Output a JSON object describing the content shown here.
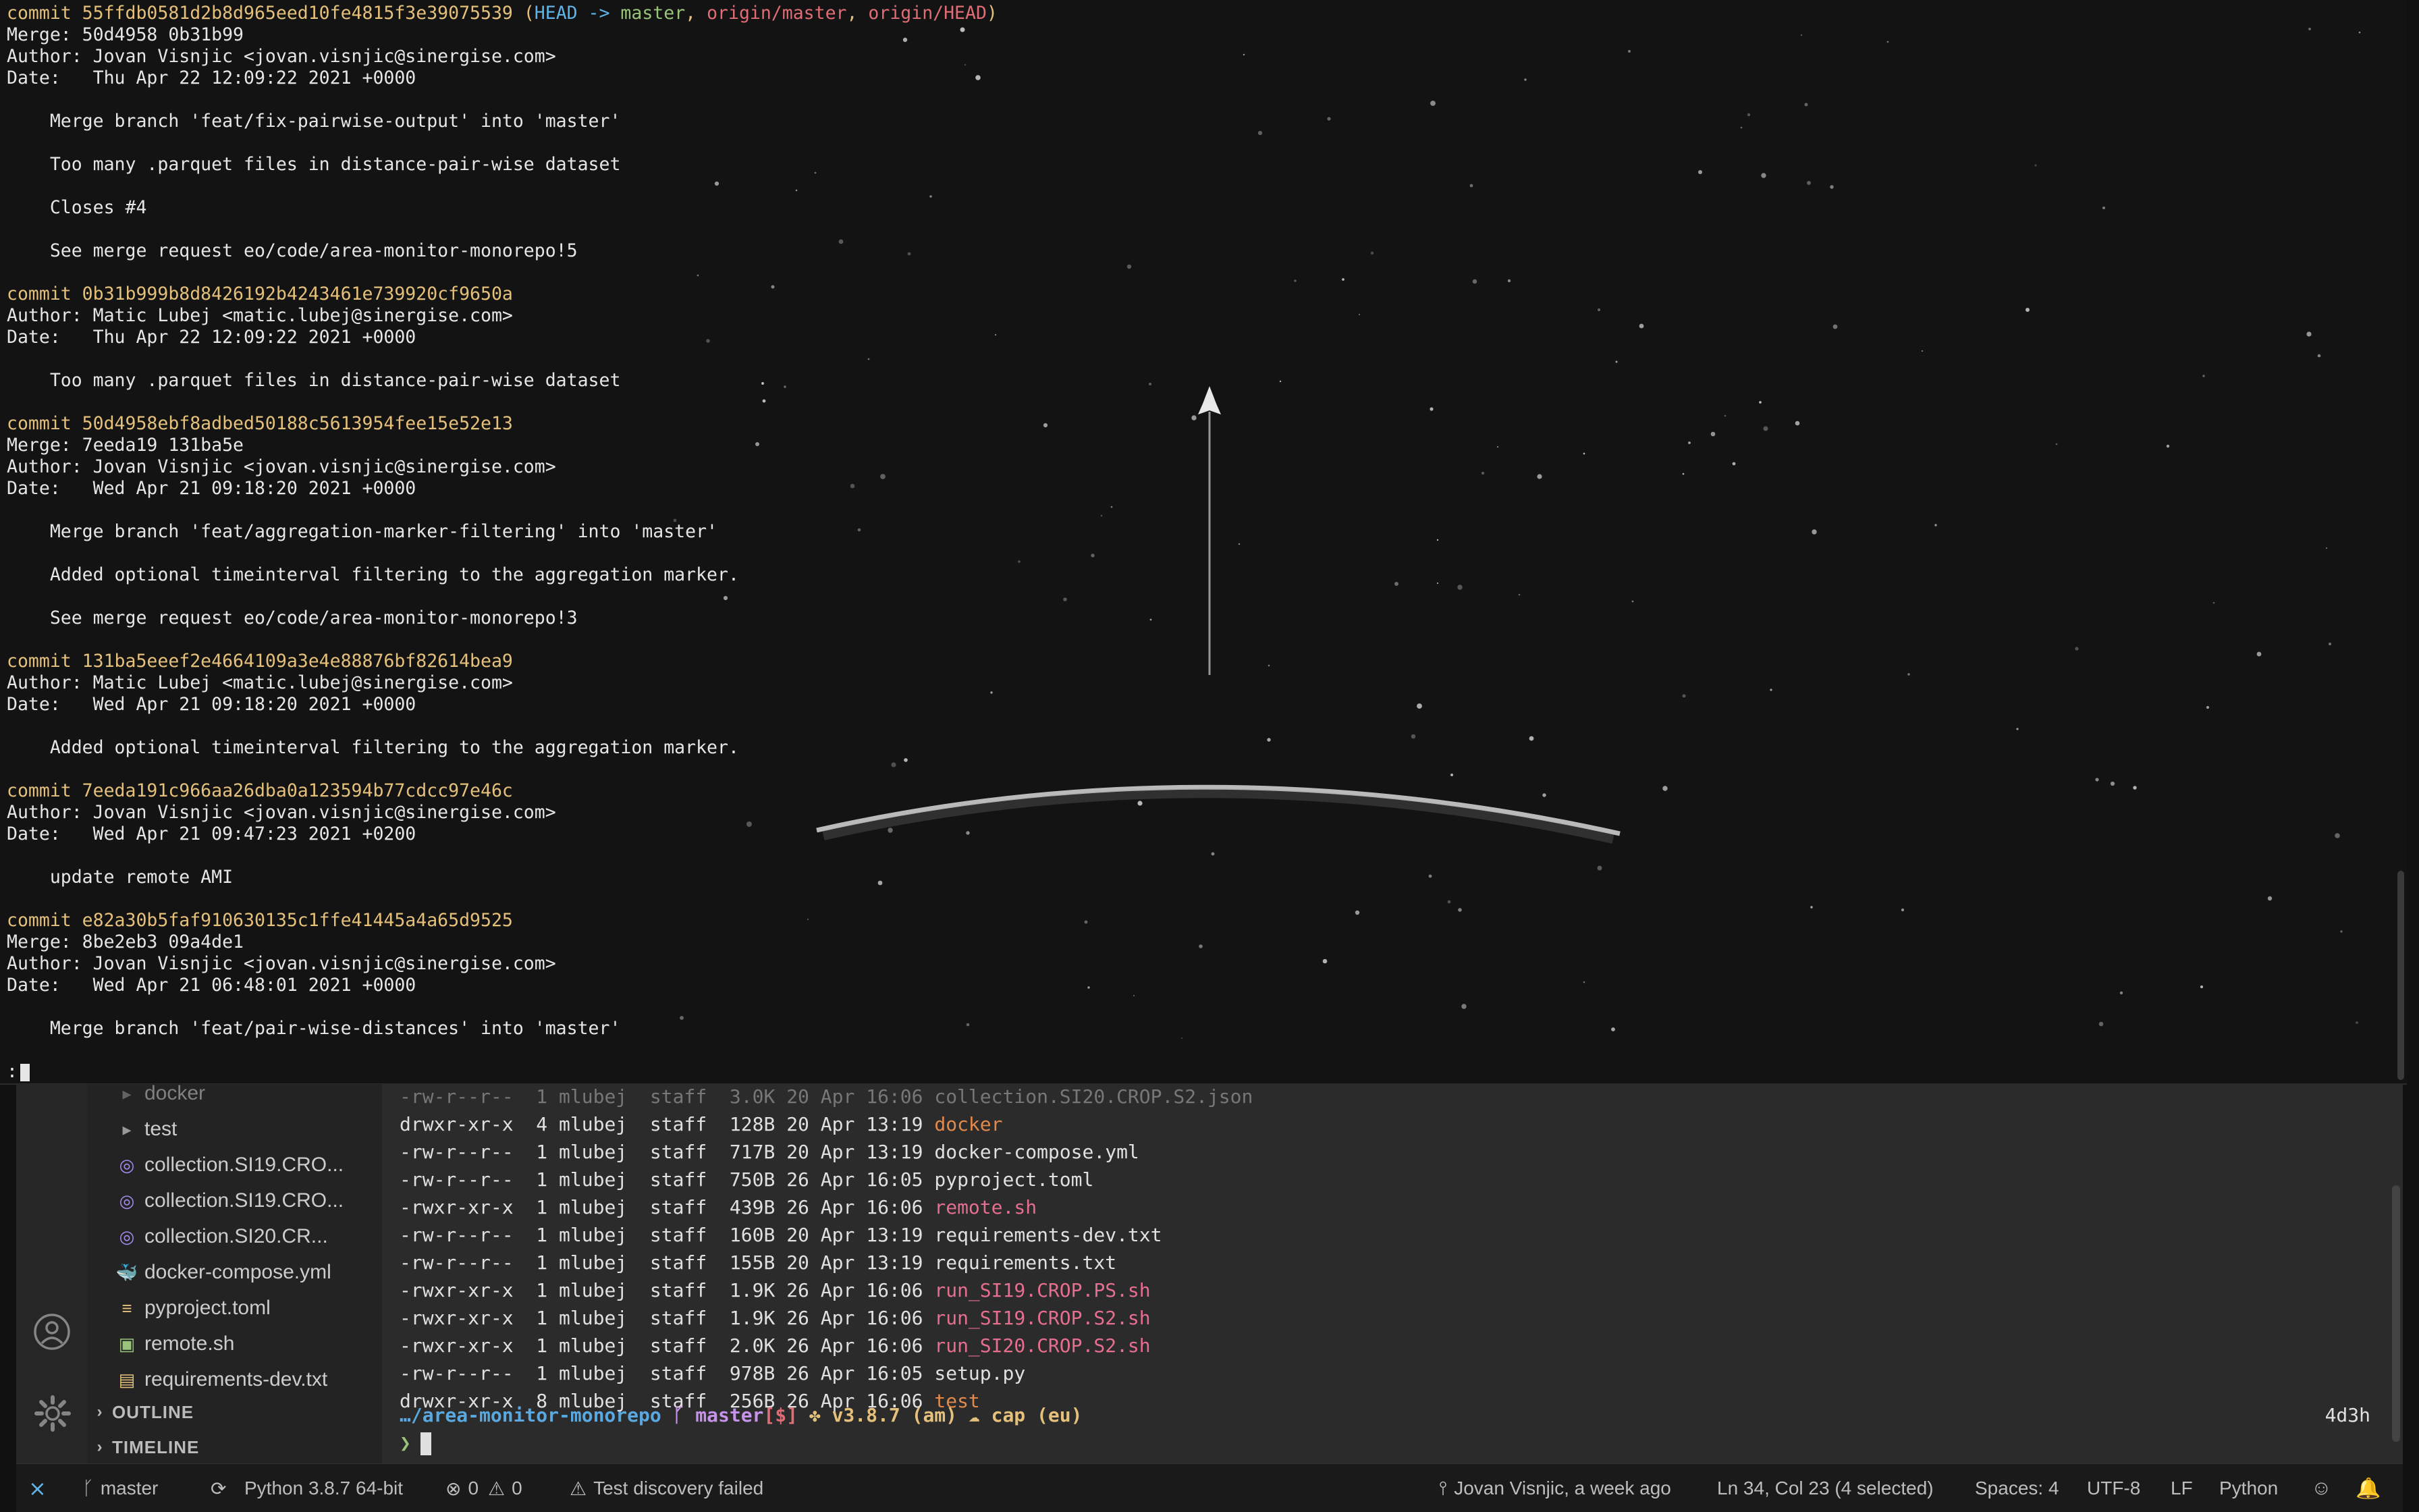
{
  "git_log": {
    "lines": [
      {
        "segments": [
          {
            "t": "commit 55ffdb0581d2b8d965eed10fe4815f3e39075539 ",
            "c": "c-commit"
          },
          {
            "t": "(",
            "c": "c-paren"
          },
          {
            "t": "HEAD -> ",
            "c": "c-head"
          },
          {
            "t": "master",
            "c": "c-branch"
          },
          {
            "t": ", ",
            "c": "c-paren"
          },
          {
            "t": "origin/master",
            "c": "c-remote"
          },
          {
            "t": ", ",
            "c": "c-paren"
          },
          {
            "t": "origin/HEAD",
            "c": "c-remote"
          },
          {
            "t": ")",
            "c": "c-paren"
          }
        ]
      },
      {
        "segments": [
          {
            "t": "Merge: 50d4958 0b31b99"
          }
        ]
      },
      {
        "segments": [
          {
            "t": "Author: Jovan Visnjic <jovan.visnjic@sinergise.com>"
          }
        ]
      },
      {
        "segments": [
          {
            "t": "Date:   Thu Apr 22 12:09:22 2021 +0000"
          }
        ]
      },
      {
        "segments": [
          {
            "t": ""
          }
        ]
      },
      {
        "segments": [
          {
            "t": "    Merge branch 'feat/fix-pairwise-output' into 'master'"
          }
        ]
      },
      {
        "segments": [
          {
            "t": ""
          }
        ]
      },
      {
        "segments": [
          {
            "t": "    Too many .parquet files in distance-pair-wise dataset"
          }
        ]
      },
      {
        "segments": [
          {
            "t": ""
          }
        ]
      },
      {
        "segments": [
          {
            "t": "    Closes #4"
          }
        ]
      },
      {
        "segments": [
          {
            "t": ""
          }
        ]
      },
      {
        "segments": [
          {
            "t": "    See merge request eo/code/area-monitor-monorepo!5"
          }
        ]
      },
      {
        "segments": [
          {
            "t": ""
          }
        ]
      },
      {
        "segments": [
          {
            "t": "commit 0b31b999b8d8426192b4243461e739920cf9650a",
            "c": "c-commit"
          }
        ]
      },
      {
        "segments": [
          {
            "t": "Author: Matic Lubej <matic.lubej@sinergise.com>"
          }
        ]
      },
      {
        "segments": [
          {
            "t": "Date:   Thu Apr 22 12:09:22 2021 +0000"
          }
        ]
      },
      {
        "segments": [
          {
            "t": ""
          }
        ]
      },
      {
        "segments": [
          {
            "t": "    Too many .parquet files in distance-pair-wise dataset"
          }
        ]
      },
      {
        "segments": [
          {
            "t": ""
          }
        ]
      },
      {
        "segments": [
          {
            "t": "commit 50d4958ebf8adbed50188c5613954fee15e52e13",
            "c": "c-commit"
          }
        ]
      },
      {
        "segments": [
          {
            "t": "Merge: 7eeda19 131ba5e"
          }
        ]
      },
      {
        "segments": [
          {
            "t": "Author: Jovan Visnjic <jovan.visnjic@sinergise.com>"
          }
        ]
      },
      {
        "segments": [
          {
            "t": "Date:   Wed Apr 21 09:18:20 2021 +0000"
          }
        ]
      },
      {
        "segments": [
          {
            "t": ""
          }
        ]
      },
      {
        "segments": [
          {
            "t": "    Merge branch 'feat/aggregation-marker-filtering' into 'master'"
          }
        ]
      },
      {
        "segments": [
          {
            "t": ""
          }
        ]
      },
      {
        "segments": [
          {
            "t": "    Added optional timeinterval filtering to the aggregation marker."
          }
        ]
      },
      {
        "segments": [
          {
            "t": ""
          }
        ]
      },
      {
        "segments": [
          {
            "t": "    See merge request eo/code/area-monitor-monorepo!3"
          }
        ]
      },
      {
        "segments": [
          {
            "t": ""
          }
        ]
      },
      {
        "segments": [
          {
            "t": "commit 131ba5eeef2e4664109a3e4e88876bf82614bea9",
            "c": "c-commit"
          }
        ]
      },
      {
        "segments": [
          {
            "t": "Author: Matic Lubej <matic.lubej@sinergise.com>"
          }
        ]
      },
      {
        "segments": [
          {
            "t": "Date:   Wed Apr 21 09:18:20 2021 +0000"
          }
        ]
      },
      {
        "segments": [
          {
            "t": ""
          }
        ]
      },
      {
        "segments": [
          {
            "t": "    Added optional timeinterval filtering to the aggregation marker."
          }
        ]
      },
      {
        "segments": [
          {
            "t": ""
          }
        ]
      },
      {
        "segments": [
          {
            "t": "commit 7eeda191c966aa26dba0a123594b77cdcc97e46c",
            "c": "c-commit"
          }
        ]
      },
      {
        "segments": [
          {
            "t": "Author: Jovan Visnjic <jovan.visnjic@sinergise.com>"
          }
        ]
      },
      {
        "segments": [
          {
            "t": "Date:   Wed Apr 21 09:47:23 2021 +0200"
          }
        ]
      },
      {
        "segments": [
          {
            "t": ""
          }
        ]
      },
      {
        "segments": [
          {
            "t": "    update remote AMI"
          }
        ]
      },
      {
        "segments": [
          {
            "t": ""
          }
        ]
      },
      {
        "segments": [
          {
            "t": "commit e82a30b5faf910630135c1ffe41445a4a65d9525",
            "c": "c-commit"
          }
        ]
      },
      {
        "segments": [
          {
            "t": "Merge: 8be2eb3 09a4de1"
          }
        ]
      },
      {
        "segments": [
          {
            "t": "Author: Jovan Visnjic <jovan.visnjic@sinergise.com>"
          }
        ]
      },
      {
        "segments": [
          {
            "t": "Date:   Wed Apr 21 06:48:01 2021 +0000"
          }
        ]
      },
      {
        "segments": [
          {
            "t": ""
          }
        ]
      },
      {
        "segments": [
          {
            "t": "    Merge branch 'feat/pair-wise-distances' into 'master'"
          }
        ]
      },
      {
        "segments": [
          {
            "t": ""
          }
        ]
      }
    ],
    "pager_prompt": ":"
  },
  "explorer": {
    "items": [
      {
        "label": "docker",
        "icon": "chevron-right-icon",
        "glyph": "▸",
        "faded": true
      },
      {
        "label": "test",
        "icon": "chevron-right-icon",
        "glyph": "▸"
      },
      {
        "label": "collection.SI19.CRO...",
        "icon": "json-schema-icon",
        "glyph": "◎"
      },
      {
        "label": "collection.SI19.CRO...",
        "icon": "json-schema-icon",
        "glyph": "◎"
      },
      {
        "label": "collection.SI20.CR...",
        "icon": "json-schema-icon",
        "glyph": "◎"
      },
      {
        "label": "docker-compose.yml",
        "icon": "docker-icon",
        "glyph": "🐳"
      },
      {
        "label": "pyproject.toml",
        "icon": "toml-file-icon",
        "glyph": "≡"
      },
      {
        "label": "remote.sh",
        "icon": "shell-script-icon",
        "glyph": "▣"
      },
      {
        "label": "requirements-dev.txt",
        "icon": "text-file-icon",
        "glyph": "▤"
      }
    ],
    "outline_label": "OUTLINE",
    "timeline_label": "TIMELINE"
  },
  "ls_listing": [
    {
      "perm": "-rw-r--r--",
      "links": "1",
      "user": "mlubej",
      "group": "staff",
      "size": "3.0K",
      "date": "20 Apr 16:06",
      "name": "collection.SI20.CROP.S2.json",
      "kind": "dim"
    },
    {
      "perm": "drwxr-xr-x",
      "links": "4",
      "user": "mlubej",
      "group": "staff",
      "size": "128B",
      "date": "20 Apr 13:19",
      "name": "docker",
      "kind": "dir"
    },
    {
      "perm": "-rw-r--r--",
      "links": "1",
      "user": "mlubej",
      "group": "staff",
      "size": "717B",
      "date": "20 Apr 13:19",
      "name": "docker-compose.yml",
      "kind": "file"
    },
    {
      "perm": "-rw-r--r--",
      "links": "1",
      "user": "mlubej",
      "group": "staff",
      "size": "750B",
      "date": "26 Apr 16:05",
      "name": "pyproject.toml",
      "kind": "file"
    },
    {
      "perm": "-rwxr-xr-x",
      "links": "1",
      "user": "mlubej",
      "group": "staff",
      "size": "439B",
      "date": "26 Apr 16:06",
      "name": "remote.sh",
      "kind": "exec"
    },
    {
      "perm": "-rw-r--r--",
      "links": "1",
      "user": "mlubej",
      "group": "staff",
      "size": "160B",
      "date": "20 Apr 13:19",
      "name": "requirements-dev.txt",
      "kind": "file"
    },
    {
      "perm": "-rw-r--r--",
      "links": "1",
      "user": "mlubej",
      "group": "staff",
      "size": "155B",
      "date": "20 Apr 13:19",
      "name": "requirements.txt",
      "kind": "file"
    },
    {
      "perm": "-rwxr-xr-x",
      "links": "1",
      "user": "mlubej",
      "group": "staff",
      "size": "1.9K",
      "date": "26 Apr 16:06",
      "name": "run_SI19.CROP.PS.sh",
      "kind": "exec"
    },
    {
      "perm": "-rwxr-xr-x",
      "links": "1",
      "user": "mlubej",
      "group": "staff",
      "size": "1.9K",
      "date": "26 Apr 16:06",
      "name": "run_SI19.CROP.S2.sh",
      "kind": "exec"
    },
    {
      "perm": "-rwxr-xr-x",
      "links": "1",
      "user": "mlubej",
      "group": "staff",
      "size": "2.0K",
      "date": "26 Apr 16:06",
      "name": "run_SI20.CROP.S2.sh",
      "kind": "exec"
    },
    {
      "perm": "-rw-r--r--",
      "links": "1",
      "user": "mlubej",
      "group": "staff",
      "size": "978B",
      "date": "26 Apr 16:05",
      "name": "setup.py",
      "kind": "file"
    },
    {
      "perm": "drwxr-xr-x",
      "links": "8",
      "user": "mlubej",
      "group": "staff",
      "size": "256B",
      "date": "26 Apr 16:06",
      "name": "test",
      "kind": "dir"
    }
  ],
  "prompt": {
    "path": "…/area-monitor-monorepo",
    "branch_icon": "git-branch-icon",
    "branch": "master",
    "status": "[$]",
    "python": "v3.8.7 (am)",
    "cloud": "cap (eu)",
    "elapsed": "4d3h",
    "symbol": "❯"
  },
  "statusbar": {
    "remote_glyph": "⨯",
    "branch": "master",
    "sync_glyph": "⟳",
    "interpreter": "Python 3.8.7 64-bit",
    "errors": "0",
    "warnings": "0",
    "test_status": "Test discovery failed",
    "blame": "Jovan Visnjic, a week ago",
    "cursor": "Ln 34, Col 23 (4 selected)",
    "spaces": "Spaces: 4",
    "encoding": "UTF-8",
    "eol": "LF",
    "language": "Python"
  },
  "colors": {
    "commit": "#e5c07b",
    "dir": "#e3894b",
    "exec": "#e66e8e",
    "path": "#5aa8e0"
  }
}
